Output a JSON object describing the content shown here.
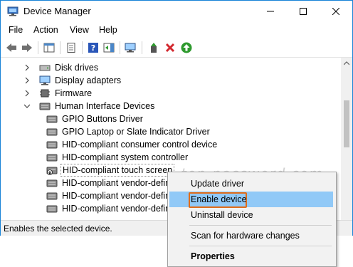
{
  "window": {
    "title": "Device Manager"
  },
  "menu": [
    "File",
    "Action",
    "View",
    "Help"
  ],
  "tree": {
    "categories": [
      {
        "label": "Disk drives",
        "expanded": false
      },
      {
        "label": "Display adapters",
        "expanded": false
      },
      {
        "label": "Firmware",
        "expanded": false
      },
      {
        "label": "Human Interface Devices",
        "expanded": true
      }
    ],
    "devices": [
      "GPIO Buttons Driver",
      "GPIO Laptop or Slate Indicator Driver",
      "HID-compliant consumer control device",
      "HID-compliant system controller",
      "HID-compliant touch screen",
      "HID-compliant vendor-defin",
      "HID-compliant vendor-defin",
      "HID-compliant vendor-defin"
    ]
  },
  "status": {
    "text": "Enables the selected device."
  },
  "watermark": "top-password.com",
  "context_menu": {
    "update": "Update driver",
    "enable": "Enable device",
    "uninstall": "Uninstall device",
    "scan": "Scan for hardware changes",
    "properties": "Properties"
  },
  "colors": {
    "accent": "#1883d7",
    "highlight": "#91c9f7",
    "outline": "#e06c1a"
  }
}
